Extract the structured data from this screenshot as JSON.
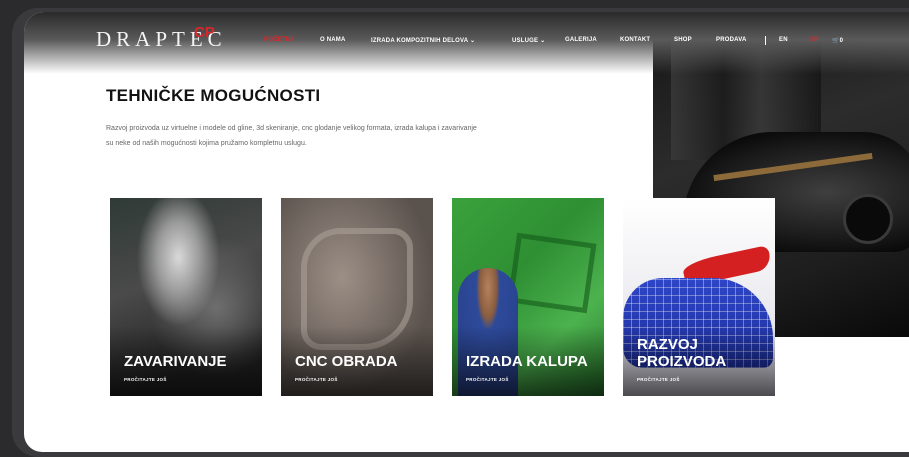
{
  "brand": {
    "logo_text": "DRAPTEC",
    "logo_mark": "CP"
  },
  "nav": {
    "items": [
      {
        "label": "POČETNA",
        "active": true
      },
      {
        "label": "O NAMA"
      },
      {
        "label": "IZRADA KOMPOZITNIH DELOVA ⌄"
      },
      {
        "label": "USLUGE ⌄"
      },
      {
        "label": "GALERIJA"
      },
      {
        "label": "KONTAKT"
      },
      {
        "label": "SHOP"
      },
      {
        "label": "PRODAVA"
      }
    ],
    "lang_en": "EN",
    "lang_sr": "SR",
    "cart_icon": "cart-icon",
    "cart_count": "0"
  },
  "section": {
    "title": "TEHNIČKE MOGUĆNOSTI",
    "description": "Razvoj proizvoda uz virtuelne i modele od gline, 3d skeniranje, cnc glodanje velikog formata, izrada kalupa i zavarivanje su neke od naših mogućnosti kojima pružamo kompletnu uslugu."
  },
  "cards": [
    {
      "title": "ZAVARIVANJE",
      "link": "PROČITAJTE JOŠ"
    },
    {
      "title": "CNC OBRADA",
      "link": "PROČITAJTE JOŠ"
    },
    {
      "title": "IZRADA KALUPA",
      "link": "PROČITAJTE JOŠ"
    },
    {
      "title": "RAZVOJ PROIZVODA",
      "link": "PROČITAJTE JOŠ"
    }
  ],
  "colors": {
    "accent": "#e0262b",
    "heading": "#121212",
    "text": "#666666"
  }
}
